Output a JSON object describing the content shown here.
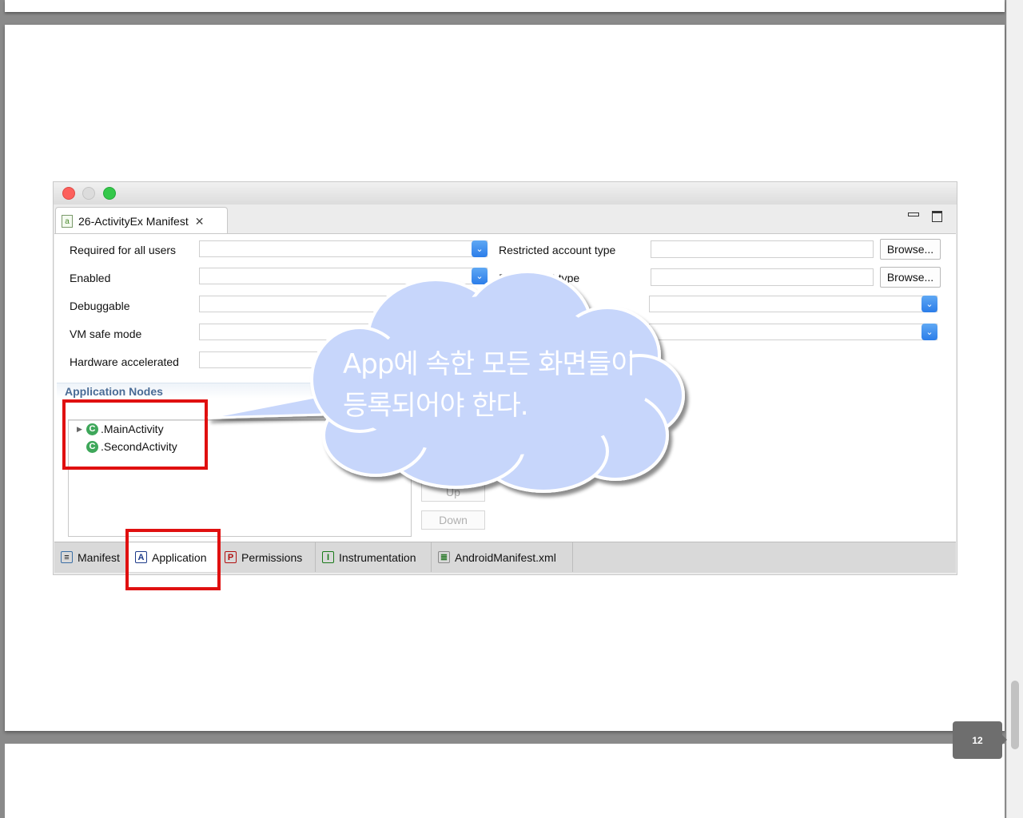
{
  "window": {
    "editor_tab_title": "26-ActivityEx Manifest",
    "editor_tab_icon": "android-manifest-icon"
  },
  "form": {
    "left_fields": [
      {
        "label": "Required for all users",
        "value": ""
      },
      {
        "label": "Enabled",
        "value": ""
      },
      {
        "label": "Debuggable",
        "value": ""
      },
      {
        "label": "VM safe mode",
        "value": ""
      },
      {
        "label": "Hardware accelerated",
        "value": ""
      }
    ],
    "right_fields": [
      {
        "label": "Restricted account type",
        "value": ""
      },
      {
        "label": "R...account type",
        "value": ""
      }
    ],
    "browse_label": "Browse..."
  },
  "application_nodes": {
    "header": "Application Nodes",
    "items": [
      ".MainActivity",
      ".SecondActivity"
    ],
    "buttons": {
      "up": "Up",
      "down": "Down"
    }
  },
  "bottom_tabs": [
    {
      "label": "Manifest",
      "icon": "manifest-icon",
      "active": false
    },
    {
      "label": "Application",
      "icon": "A",
      "active": true
    },
    {
      "label": "Permissions",
      "icon": "P",
      "active": false
    },
    {
      "label": "Instrumentation",
      "icon": "I",
      "active": false
    },
    {
      "label": "AndroidManifest.xml",
      "icon": "xml-file-icon",
      "active": false
    }
  ],
  "callout": {
    "line1": "App에 속한 모든 화면들이",
    "line2": "등록되어야 한다."
  },
  "page_number": "12",
  "colors": {
    "highlight_red": "#e01010",
    "cloud_fill": "#c7d6fb",
    "combo_blue": "#2b7de9"
  }
}
